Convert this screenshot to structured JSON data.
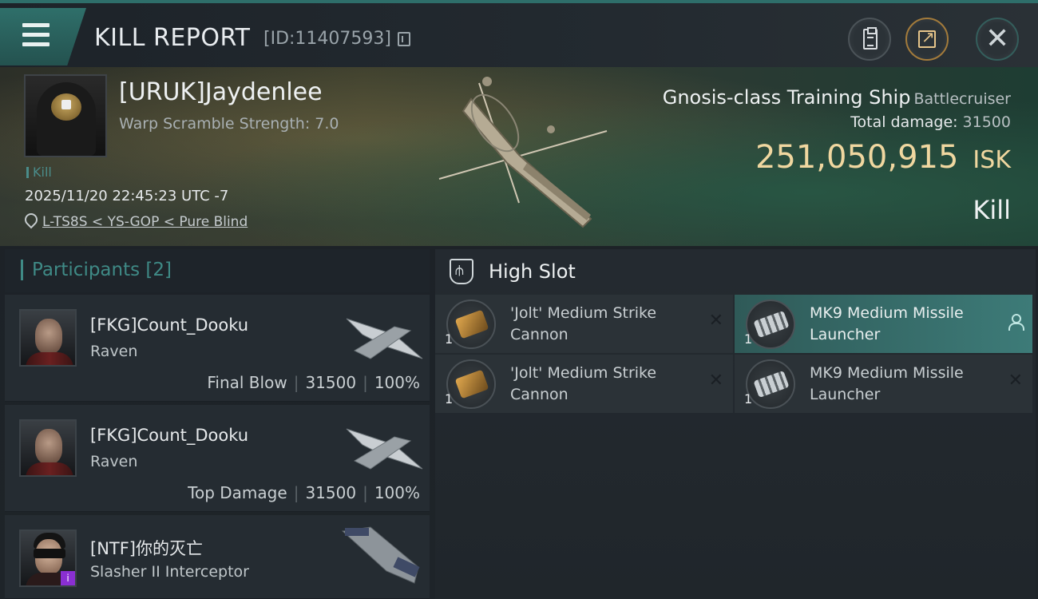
{
  "header": {
    "title": "KILL REPORT",
    "report_id": "[ID:11407593]"
  },
  "victim": {
    "name": "[URUK]Jaydenlee",
    "warp_scramble": "Warp Scramble Strength: 7.0",
    "tag": "Kill",
    "datetime": "2025/11/20 22:45:23 UTC -7",
    "location": "L-TS8S < YS-GOP < Pure Blind"
  },
  "ship": {
    "name": "Gnosis-class Training Ship",
    "class": "Battlecruiser",
    "total_damage_label": "Total damage:",
    "total_damage": "31500",
    "isk_value": "251,050,915",
    "isk_unit": "ISK",
    "result": "Kill"
  },
  "participants": {
    "title": "Participants",
    "count": "[2]",
    "rows": [
      {
        "name": "[FKG]Count_Dooku",
        "ship": "Raven",
        "role": "Final Blow",
        "damage": "31500",
        "percent": "100%"
      },
      {
        "name": "[FKG]Count_Dooku",
        "ship": "Raven",
        "role": "Top Damage",
        "damage": "31500",
        "percent": "100%"
      },
      {
        "name": "[NTF]你的灭亡",
        "ship": "Slasher II Interceptor",
        "badge": "i"
      }
    ]
  },
  "high_slot": {
    "title": "High Slot",
    "modules": [
      {
        "name": "'Jolt' Medium Strike Cannon",
        "qty": "1",
        "status": "destroyed"
      },
      {
        "name": "MK9 Medium Missile Launcher",
        "qty": "1",
        "status": "dropped"
      },
      {
        "name": "'Jolt' Medium Strike Cannon",
        "qty": "1",
        "status": "destroyed"
      },
      {
        "name": "MK9 Medium Missile Launcher",
        "qty": "1",
        "status": "destroyed"
      }
    ],
    "destroyed_glyph": "✕"
  },
  "colors": {
    "accent_teal": "#3f8a86",
    "isk_gold": "#f0d7a0",
    "active_module": "#3d7b78"
  }
}
